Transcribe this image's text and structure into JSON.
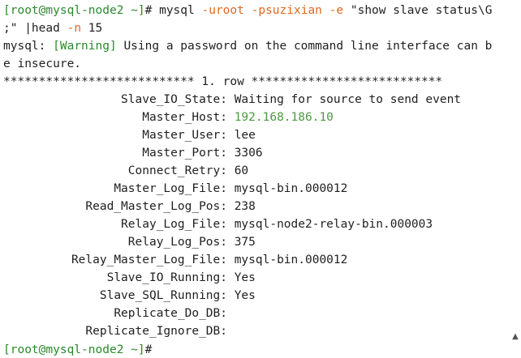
{
  "prompt": {
    "user": "root",
    "host": "mysql-node2",
    "path": "~",
    "symbol": "#"
  },
  "command": {
    "program": "mysql",
    "opt_user": "-uroot",
    "opt_password": "-psuzixian",
    "opt_exec": "-e",
    "query_part1": "\"show slave status\\G",
    "query_part2": ";\"",
    "pipe": "|head",
    "head_opt": "-n",
    "head_count": "15"
  },
  "warning": {
    "prefix": "mysql:",
    "tag": "[Warning]",
    "text_line1": "Using a password on the command line interface can b",
    "text_line2": "e insecure."
  },
  "row_header": "*************************** 1. row ***************************",
  "status_rows": [
    {
      "key": "Slave_IO_State:",
      "value": "Waiting for source to send event"
    },
    {
      "key": "Master_Host:",
      "value": "192.168.186.10"
    },
    {
      "key": "Master_User:",
      "value": "lee"
    },
    {
      "key": "Master_Port:",
      "value": "3306"
    },
    {
      "key": "Connect_Retry:",
      "value": "60"
    },
    {
      "key": "Master_Log_File:",
      "value": "mysql-bin.000012"
    },
    {
      "key": "Read_Master_Log_Pos:",
      "value": "238"
    },
    {
      "key": "Relay_Log_File:",
      "value": "mysql-node2-relay-bin.000003"
    },
    {
      "key": "Relay_Log_Pos:",
      "value": "375"
    },
    {
      "key": "Relay_Master_Log_File:",
      "value": "mysql-bin.000012"
    },
    {
      "key": "Slave_IO_Running:",
      "value": "Yes"
    },
    {
      "key": "Slave_SQL_Running:",
      "value": "Yes"
    },
    {
      "key": "Replicate_Do_DB:",
      "value": ""
    },
    {
      "key": "Replicate_Ignore_DB:",
      "value": ""
    }
  ],
  "colors": {
    "prompt": "#2a8a2a",
    "option": "#e0681b",
    "ip": "#4a9a3f",
    "text": "#1f1f1f",
    "background": "#ffffff"
  },
  "scroll_icon": "scroll-down-arrow-icon"
}
